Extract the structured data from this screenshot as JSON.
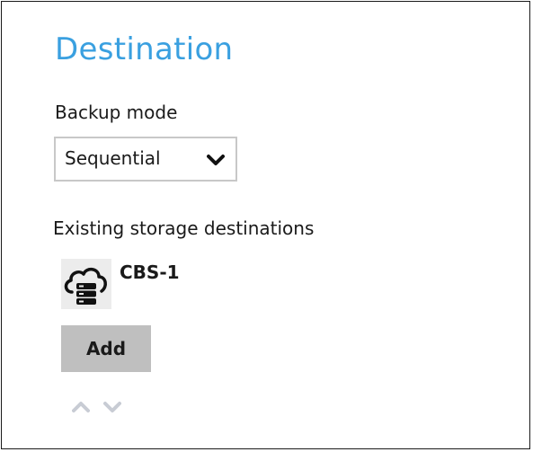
{
  "destination": {
    "title": "Destination",
    "backup_mode_label": "Backup mode",
    "backup_mode_selected": "Sequential",
    "existing_storage_label": "Existing storage destinations",
    "storage_items": [
      {
        "name": "CBS-1",
        "icon": "cloud-server-icon"
      }
    ],
    "add_label": "Add",
    "move_up_icon": "chevron-up-icon",
    "move_down_icon": "chevron-down-icon"
  },
  "colors": {
    "title": "#3aa0e0",
    "add_button_bg": "#bfbfbf",
    "icon_box_bg": "#ececec",
    "arrow_disabled": "#c8ccd4",
    "select_border": "#c8c8c8"
  }
}
